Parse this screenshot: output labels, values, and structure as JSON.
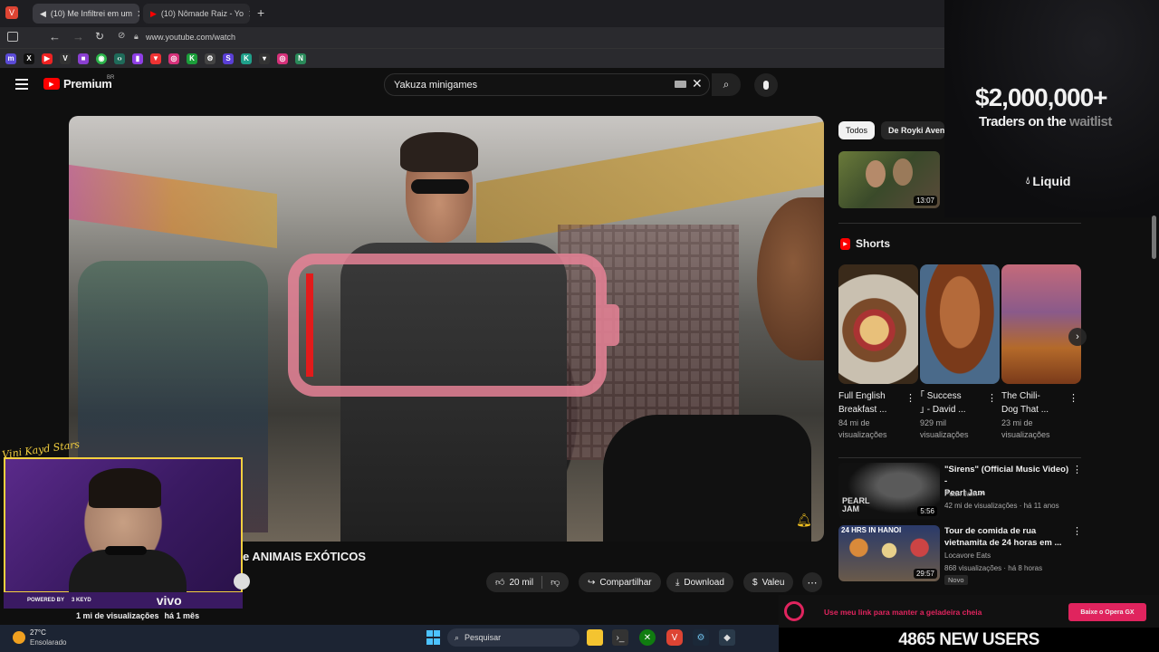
{
  "browser": {
    "tabs": [
      {
        "label": "(10) Me Infiltrei em um",
        "active": true
      },
      {
        "label": "(10) Nômade Raiz - Yo",
        "active": false
      }
    ],
    "url": "www.youtube.com/watch"
  },
  "youtube": {
    "logo": "Premium",
    "region": "BR",
    "search_value": "Yakuza minigames",
    "video": {
      "title_partial": "e ANIMAIS EXÓTICOS",
      "views": "1 mi de visualizações",
      "age": "há 1 mês",
      "likes": "20 mil",
      "share": "Compartilhar",
      "download": "Download",
      "thanks": "Valeu"
    },
    "chips": [
      "Todos",
      "De Royki Avent"
    ],
    "top_rec_duration": "13:07",
    "shorts_heading": "Shorts",
    "shorts": [
      {
        "title1": "Full English",
        "title2": "Breakfast ...",
        "views1": "84 mi de",
        "views2": "visualizações"
      },
      {
        "title1": "｢ Success",
        "title2": "｣ - David ...",
        "views1": "929 mil",
        "views2": "visualizações"
      },
      {
        "title1": "The Chili-",
        "title2": "Dog That ...",
        "views1": "23 mi de",
        "views2": "visualizações"
      }
    ],
    "recs": [
      {
        "title1": "\"Sirens\" (Official Music Video) -",
        "title2": "Pearl Jam",
        "channel": "Pearl Jam",
        "meta": "42 mi de visualizações · há 11 anos",
        "duration": "5:56"
      },
      {
        "title1": "Tour de comida de rua",
        "title2": "vietnamita de 24 horas em ...",
        "channel": "Locavore Eats",
        "meta": "868 visualizações · há 8 horas",
        "badge": "Novo",
        "duration": "29:57"
      }
    ]
  },
  "ad": {
    "amount": "$2,000,000+",
    "line": "Traders on the",
    "highlight": "waitlist",
    "brand": "Liquid"
  },
  "stream": {
    "signature": "Vini Kayd Stars",
    "powered_by": "POWERED BY",
    "sponsor": "vivo",
    "bottom_promo": "Use meu link para manter a geladeira cheia",
    "promo_button": "Baixe o Opera GX",
    "new_users": "4865 NEW USERS",
    "thumb_in_video": "3 KEYD"
  },
  "taskbar": {
    "temp": "27°C",
    "weather": "Ensolarado",
    "search": "Pesquisar"
  }
}
